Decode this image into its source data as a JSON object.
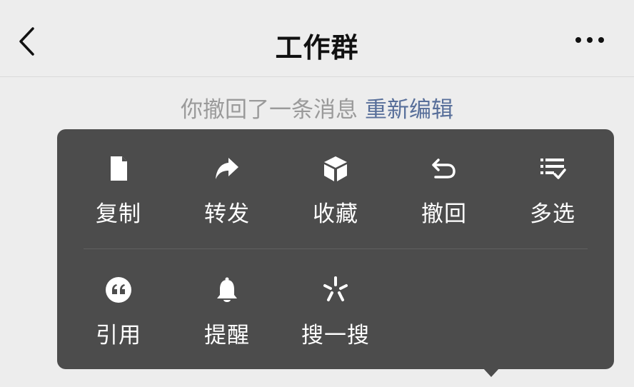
{
  "header": {
    "title": "工作群"
  },
  "notice": {
    "text": "你撤回了一条消息",
    "link": "重新编辑"
  },
  "menu": {
    "row1": [
      {
        "label": "复制",
        "icon": "document-icon"
      },
      {
        "label": "转发",
        "icon": "forward-arrow-icon"
      },
      {
        "label": "收藏",
        "icon": "cube-icon"
      },
      {
        "label": "撤回",
        "icon": "undo-arrow-icon"
      },
      {
        "label": "多选",
        "icon": "checklist-icon"
      }
    ],
    "row2": [
      {
        "label": "引用",
        "icon": "quote-icon"
      },
      {
        "label": "提醒",
        "icon": "bell-icon"
      },
      {
        "label": "搜一搜",
        "icon": "sparkle-search-icon"
      }
    ]
  },
  "colors": {
    "background": "#ededed",
    "menu": "#4c4c4c",
    "link": "#586f9a"
  }
}
